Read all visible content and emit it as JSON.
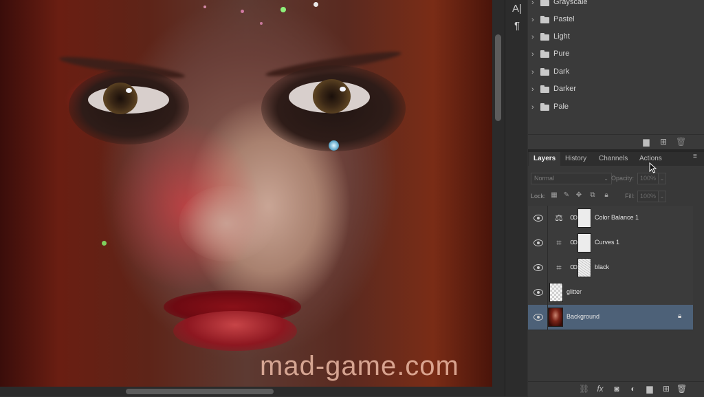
{
  "canvas": {
    "watermark": "mad-game.com"
  },
  "toolstrip": {
    "items": [
      {
        "icon": "character-panel-icon",
        "glyph": "A|"
      },
      {
        "icon": "paragraph-panel-icon",
        "glyph": "¶"
      }
    ]
  },
  "swatches": {
    "groups": [
      {
        "label": "Grayscale"
      },
      {
        "label": "Pastel"
      },
      {
        "label": "Light"
      },
      {
        "label": "Pure"
      },
      {
        "label": "Dark"
      },
      {
        "label": "Darker"
      },
      {
        "label": "Pale"
      }
    ],
    "footer_icons": [
      "new-group-folder-icon",
      "new-swatch-icon",
      "trash-icon"
    ]
  },
  "layers_panel": {
    "tabs": [
      {
        "label": "Layers",
        "active": true
      },
      {
        "label": "History",
        "active": false
      },
      {
        "label": "Channels",
        "active": false
      },
      {
        "label": "Actions",
        "active": false
      }
    ],
    "blend_mode": "Normal",
    "opacity_label": "Opacity:",
    "opacity_value": "100%",
    "lock_label": "Lock:",
    "fill_label": "Fill:",
    "fill_value": "100%",
    "lock_icons": [
      "lock-transparent-pixels-icon",
      "lock-image-pixels-icon",
      "lock-position-icon",
      "lock-artboard-icon",
      "lock-all-icon"
    ],
    "layers": [
      {
        "name": "Color Balance 1",
        "type": "adjustment",
        "adjustment_icon": "color-balance-icon",
        "mask": "white",
        "selected": false,
        "locked": false
      },
      {
        "name": "Curves 1",
        "type": "adjustment",
        "adjustment_icon": "curves-icon",
        "mask": "white",
        "selected": false,
        "locked": false
      },
      {
        "name": "black",
        "type": "adjustment",
        "adjustment_icon": "curves-icon",
        "mask": "sketch",
        "selected": false,
        "locked": false
      },
      {
        "name": "glitter",
        "type": "pixel",
        "thumb": "checker",
        "selected": false,
        "locked": false
      },
      {
        "name": "Background",
        "type": "pixel",
        "thumb": "photo",
        "selected": true,
        "locked": true
      }
    ],
    "footer_icons": [
      "link-layers-icon",
      "fx-icon",
      "add-mask-icon",
      "adjustment-layer-icon",
      "group-folder-icon",
      "new-layer-icon",
      "trash-icon"
    ]
  },
  "colors": {
    "panel_bg": "#383838",
    "selected_row": "#4d6178",
    "app_bg": "#323232"
  }
}
